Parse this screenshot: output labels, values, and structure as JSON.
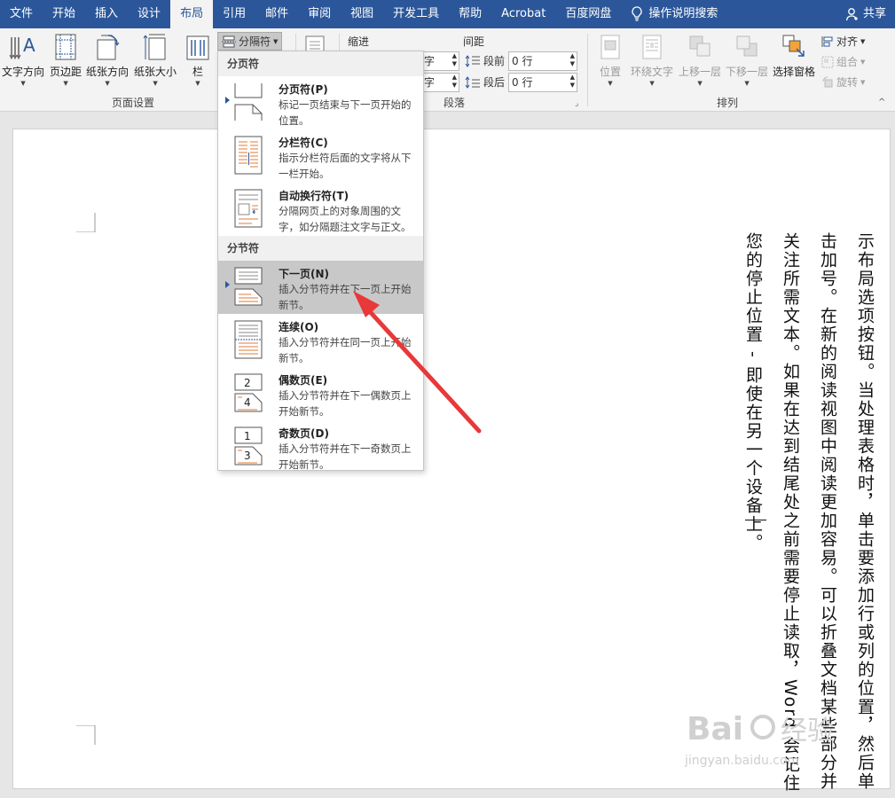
{
  "menubar": {
    "tabs": [
      "文件",
      "开始",
      "插入",
      "设计",
      "布局",
      "引用",
      "邮件",
      "审阅",
      "视图",
      "开发工具",
      "帮助",
      "Acrobat",
      "百度网盘"
    ],
    "active_tab": "布局",
    "tell_me": "操作说明搜索",
    "share": "共享",
    "bar_color": "#2b579a"
  },
  "ribbon": {
    "page_setup": {
      "text_direction": "文字方向",
      "margins": "页边距",
      "orientation": "纸张方向",
      "size": "纸张大小",
      "columns": "栏",
      "breaks": "分隔符",
      "label": "页面设置"
    },
    "paragraph": {
      "indent": "缩进",
      "spacing": "间距",
      "before_label": "段前",
      "after_label": "段后",
      "before_value": "0 行",
      "after_value": "0 行",
      "indent_left_value": "字",
      "indent_right_value": "字",
      "label": "段落"
    },
    "arrange": {
      "position": "位置",
      "wrap_text": "环绕文字",
      "bring_forward": "上移一层",
      "send_backward": "下移一层",
      "selection_pane": "选择窗格",
      "align": "对齐",
      "group": "组合",
      "rotate": "旋转",
      "label": "排列"
    }
  },
  "dropdown": {
    "section_page_breaks": "分页符",
    "section_section_breaks": "分节符",
    "items": [
      {
        "title": "分页符(P)",
        "desc1": "标记一页结束与下一页开始的",
        "desc2": "位置。"
      },
      {
        "title": "分栏符(C)",
        "desc1": "指示分栏符后面的文字将从下",
        "desc2": "一栏开始。"
      },
      {
        "title": "自动换行符(T)",
        "desc1": "分隔网页上的对象周围的文",
        "desc2": "字，如分隔题注文字与正文。"
      },
      {
        "title": "下一页(N)",
        "desc1": "插入分节符并在下一页上开始",
        "desc2": "新节。"
      },
      {
        "title": "连续(O)",
        "desc1": "插入分节符并在同一页上开始",
        "desc2": "新节。"
      },
      {
        "title": "偶数页(E)",
        "desc1": "插入分节符并在下一偶数页上",
        "desc2": "开始新节。"
      },
      {
        "title": "奇数页(D)",
        "desc1": "插入分节符并在下一奇数页上",
        "desc2": "开始新节。"
      }
    ],
    "highlight_color": "#c8c8c8"
  },
  "document": {
    "columns": [
      "示布局选项按钮。当处理表格时，单击要添加行或列的位置，然后单",
      "击加号。在新的阅读视图中阅读更加容易。可以折叠文档某些部分并",
      "关注所需文本。如果在达到结尾处之前需要停止读取，Word 会记住",
      "您的停止位置 - 即使在另一个设备上。"
    ]
  },
  "annotation": {
    "arrow_color": "#e8383a"
  },
  "watermark": {
    "text": "Bai经验",
    "url": "jingyan.baidu.com"
  }
}
